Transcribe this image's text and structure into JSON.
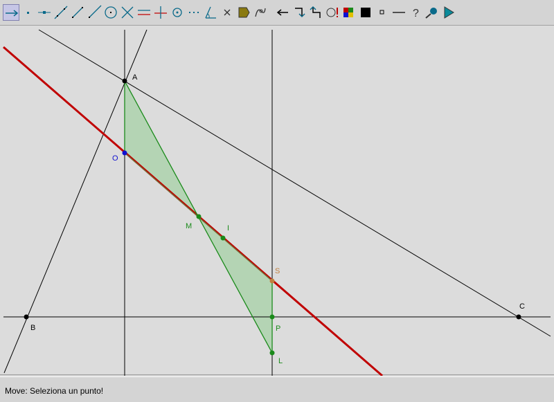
{
  "toolbar": {
    "tools": [
      {
        "name": "move-tool",
        "icon": "move-arrow-icon",
        "selected": true
      },
      {
        "name": "new-point-tool",
        "icon": "point-icon"
      },
      {
        "name": "point-on-line-tool",
        "icon": "point-on-line-icon"
      },
      {
        "name": "line-tool",
        "icon": "line-icon"
      },
      {
        "name": "segment-tool",
        "icon": "segment-icon"
      },
      {
        "name": "ray-tool",
        "icon": "ray-icon"
      },
      {
        "name": "circle-tool",
        "icon": "circle-icon"
      },
      {
        "name": "intersection-tool",
        "icon": "intersect-icon"
      },
      {
        "name": "parallel-tool",
        "icon": "parallel-icon"
      },
      {
        "name": "perpendicular-tool",
        "icon": "perpendicular-icon"
      },
      {
        "name": "midpoint-tool",
        "icon": "midpoint-icon"
      },
      {
        "name": "dotted-line-tool",
        "icon": "dotted-icon"
      },
      {
        "name": "angle-tool",
        "icon": "angle-icon"
      },
      {
        "name": "delete-tool",
        "icon": "delete-x-icon"
      },
      {
        "name": "polygon-tool",
        "icon": "polygon-icon"
      },
      {
        "name": "locus-tool",
        "icon": "locus-icon"
      },
      {
        "name": "undo-tool",
        "icon": "undo-arrow-icon"
      },
      {
        "name": "redo-tool",
        "icon": "redo-icon"
      },
      {
        "name": "back-tool",
        "icon": "back-icon"
      },
      {
        "name": "macro-tool",
        "icon": "macro-icon"
      },
      {
        "name": "color-tool",
        "icon": "color-palette-icon"
      },
      {
        "name": "fill-tool",
        "icon": "fill-square-icon"
      },
      {
        "name": "point-style-tool",
        "icon": "small-square-icon"
      },
      {
        "name": "line-style-tool",
        "icon": "line-style-icon"
      },
      {
        "name": "help-tool",
        "icon": "question-icon"
      },
      {
        "name": "zoom-tool",
        "icon": "magnifier-icon"
      },
      {
        "name": "play-tool",
        "icon": "play-triangle-icon"
      }
    ]
  },
  "canvas": {
    "colors": {
      "black": "#000000",
      "red_line": "#c00000",
      "green": "#1a8a1a",
      "fill": "#b4d4b4",
      "blue": "#1010d0",
      "orange": "#c08040"
    },
    "points": [
      {
        "id": "A",
        "label": "A",
        "color": "#000000"
      },
      {
        "id": "B",
        "label": "B",
        "color": "#000000"
      },
      {
        "id": "C",
        "label": "C",
        "color": "#000000"
      },
      {
        "id": "O",
        "label": "O",
        "color": "#1010d0"
      },
      {
        "id": "M",
        "label": "M",
        "color": "#1a8a1a"
      },
      {
        "id": "I",
        "label": "I",
        "color": "#1a8a1a"
      },
      {
        "id": "S",
        "label": "S",
        "color": "#c08040"
      },
      {
        "id": "P",
        "label": "P",
        "color": "#1a8a1a"
      },
      {
        "id": "L",
        "label": "L",
        "color": "#1a8a1a"
      }
    ]
  },
  "status": {
    "text": "Move: Seleziona un punto!"
  }
}
